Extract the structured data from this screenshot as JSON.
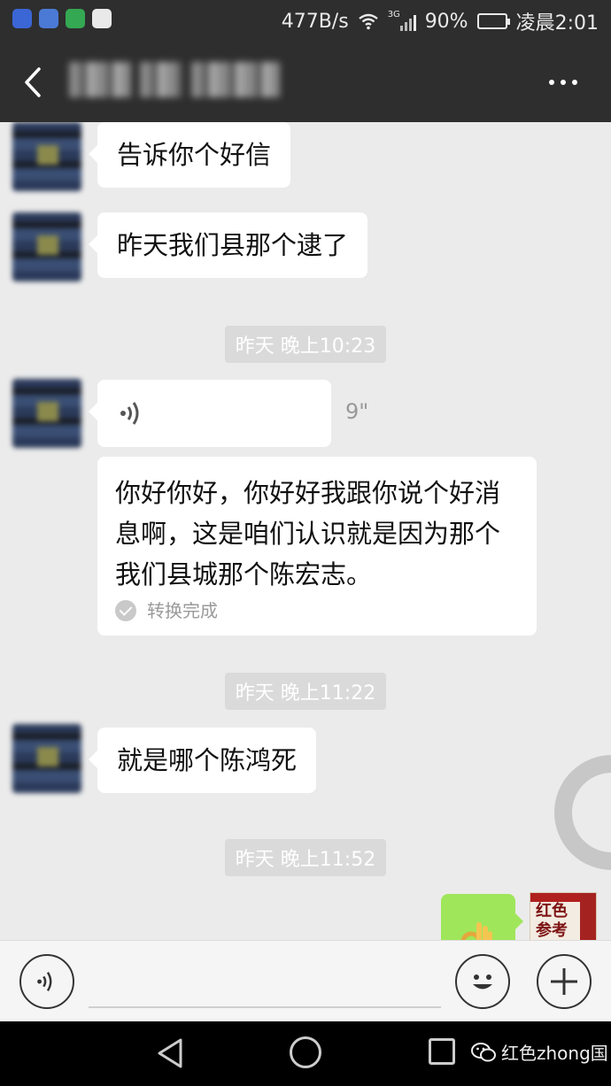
{
  "status_bar": {
    "speed": "477B/s",
    "network_tag": "3G",
    "battery": "90%",
    "battery_level": 0.9,
    "time": "凌晨2:01",
    "app_icons": [
      "video-app-icon",
      "music-app-icon",
      "player-app-icon",
      "map-app-icon"
    ]
  },
  "header": {
    "contact_name": "",
    "back_icon": "chevron-left-icon",
    "more_icon": "more-dots-icon"
  },
  "messages": [
    {
      "type": "text",
      "side": "left",
      "text": "告诉你个好信"
    },
    {
      "type": "text",
      "side": "left",
      "text": "昨天我们县那个逮了"
    },
    {
      "type": "time",
      "text": "昨天 晚上10:23"
    },
    {
      "type": "voice",
      "side": "left",
      "duration": "9\""
    },
    {
      "type": "transcript",
      "side": "left",
      "text": "你好你好，你好好我跟你说个好消息啊，这是咱们认识就是因为那个我们县城那个陈宏志。",
      "status": "转换完成"
    },
    {
      "type": "time",
      "text": "昨天 晚上11:22"
    },
    {
      "type": "text",
      "side": "left",
      "text": "就是哪个陈鸿死"
    },
    {
      "type": "time",
      "text": "昨天 晚上11:52"
    },
    {
      "type": "sticker",
      "side": "right",
      "icon": "ok-hand-icon"
    }
  ],
  "self_avatar": {
    "logo_text": "红色参考"
  },
  "input_bar": {
    "voice_icon": "voice-toggle-icon",
    "emoji_icon": "emoji-icon",
    "plus_icon": "plus-icon",
    "placeholder": ""
  },
  "nav_bar": {
    "watermark": "红色zhong国"
  },
  "colors": {
    "bar_bg": "#2e2e2e",
    "chat_bg": "#ebebeb",
    "sent_bubble": "#9fe65a",
    "timestamp_bg": "#dadada"
  }
}
